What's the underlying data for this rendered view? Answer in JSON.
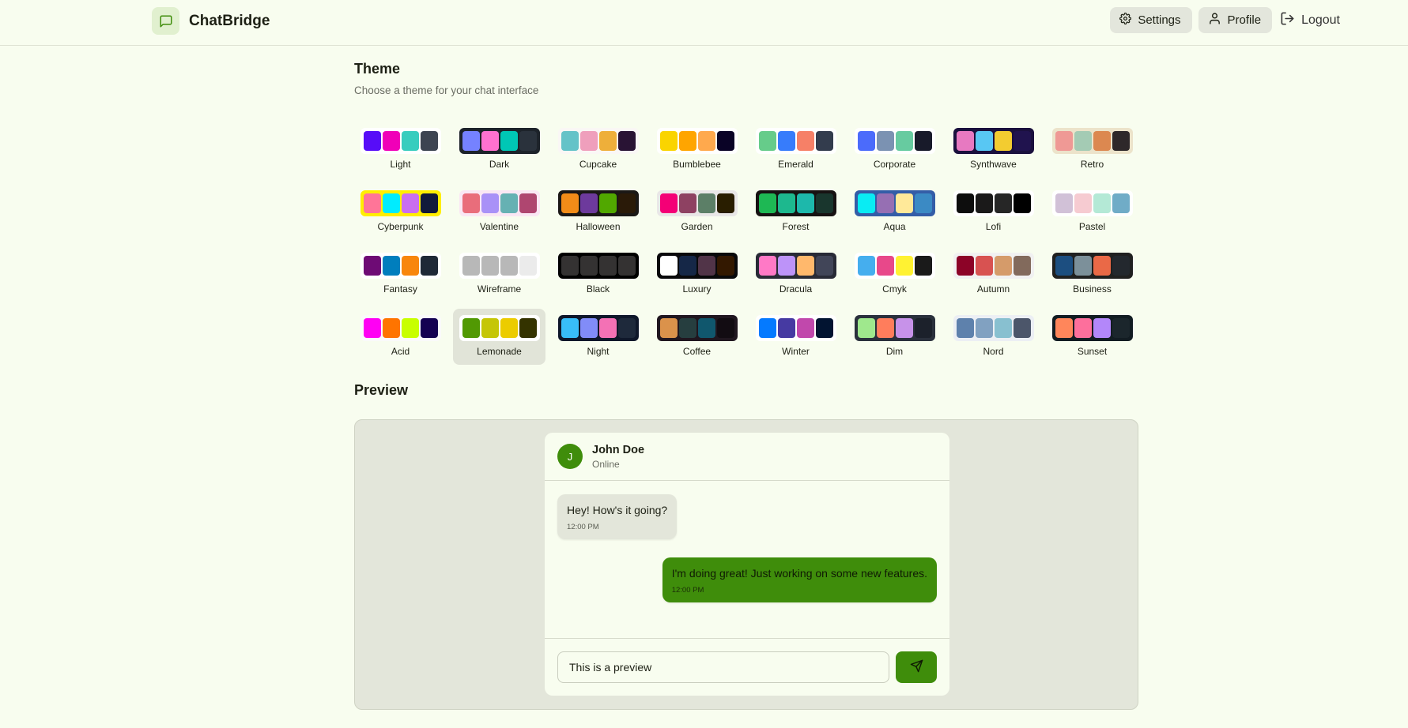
{
  "header": {
    "app_name": "ChatBridge",
    "logo_icon": "message-square-icon",
    "accent": "#3f8d0b",
    "nav": {
      "settings_label": "Settings",
      "profile_label": "Profile",
      "logout_label": "Logout"
    }
  },
  "theme_section": {
    "title": "Theme",
    "subtitle": "Choose a theme for your chat interface",
    "selected": "Lemonade",
    "themes": [
      {
        "name": "Light",
        "bg": "#ffffff",
        "border": "#ffffff",
        "colors": [
          "#570df8",
          "#f000b8",
          "#37cdbe",
          "#3d4451"
        ]
      },
      {
        "name": "Dark",
        "bg": "#1d232a",
        "border": "#1d232a",
        "colors": [
          "#7582ff",
          "#ff71cf",
          "#00c7b5",
          "#2a323c"
        ]
      },
      {
        "name": "Cupcake",
        "bg": "#faf7f5",
        "border": "#faf7f5",
        "colors": [
          "#65c3c8",
          "#ef9fbc",
          "#eeaf3a",
          "#291334"
        ]
      },
      {
        "name": "Bumblebee",
        "bg": "#ffffff",
        "border": "#ffffff",
        "colors": [
          "#fad400",
          "#ffa500",
          "#ffa94d",
          "#0a0326"
        ]
      },
      {
        "name": "Emerald",
        "bg": "#ffffff",
        "border": "#ffffff",
        "colors": [
          "#66cc8a",
          "#377cfb",
          "#f68067",
          "#333c4d"
        ]
      },
      {
        "name": "Corporate",
        "bg": "#ffffff",
        "border": "#ffffff",
        "colors": [
          "#4b6bfb",
          "#7b92b2",
          "#67cba0",
          "#181a2a"
        ]
      },
      {
        "name": "Synthwave",
        "bg": "#1a103d",
        "border": "#1a103d",
        "colors": [
          "#e779c1",
          "#58c7f3",
          "#f3cc30",
          "#20134e"
        ]
      },
      {
        "name": "Retro",
        "bg": "#ece3ca",
        "border": "#ece3ca",
        "colors": [
          "#ef9995",
          "#a4cbb4",
          "#dc8850",
          "#2e282a"
        ]
      },
      {
        "name": "Cyberpunk",
        "bg": "#ffee00",
        "border": "#ffee00",
        "colors": [
          "#ff7598",
          "#00ecff",
          "#c96ef0",
          "#111a3b"
        ]
      },
      {
        "name": "Valentine",
        "bg": "#fae7f4",
        "border": "#fae7f4",
        "colors": [
          "#e96d7b",
          "#a991f7",
          "#66b1b3",
          "#af4670"
        ]
      },
      {
        "name": "Halloween",
        "bg": "#1b1816",
        "border": "#1b1816",
        "colors": [
          "#f28c18",
          "#6d3a9c",
          "#51a800",
          "#2a1a08"
        ]
      },
      {
        "name": "Garden",
        "bg": "#e9e7e7",
        "border": "#e9e7e7",
        "colors": [
          "#f40076",
          "#8e4162",
          "#5c7f67",
          "#291e00"
        ]
      },
      {
        "name": "Forest",
        "bg": "#171212",
        "border": "#171212",
        "colors": [
          "#1eb854",
          "#1db88e",
          "#1db8ab",
          "#19362d"
        ]
      },
      {
        "name": "Aqua",
        "bg": "#345da7",
        "border": "#345da7",
        "colors": [
          "#09ecf3",
          "#966fb3",
          "#ffe999",
          "#3b8ac4"
        ]
      },
      {
        "name": "Lofi",
        "bg": "#ffffff",
        "border": "#ffffff",
        "colors": [
          "#0d0d0d",
          "#1a1919",
          "#262626",
          "#000000"
        ]
      },
      {
        "name": "Pastel",
        "bg": "#ffffff",
        "border": "#ffffff",
        "colors": [
          "#d1c1d7",
          "#f6cbd1",
          "#b4e9d6",
          "#70acc7"
        ]
      },
      {
        "name": "Fantasy",
        "bg": "#ffffff",
        "border": "#ffffff",
        "colors": [
          "#6e0b75",
          "#007ebd",
          "#f8860d",
          "#1f2937"
        ]
      },
      {
        "name": "Wireframe",
        "bg": "#ffffff",
        "border": "#ffffff",
        "colors": [
          "#b8b8b8",
          "#b8b8b8",
          "#b8b8b8",
          "#ebebeb"
        ]
      },
      {
        "name": "Black",
        "bg": "#000000",
        "border": "#000000",
        "colors": [
          "#343232",
          "#343232",
          "#343232",
          "#343232"
        ]
      },
      {
        "name": "Luxury",
        "bg": "#09090b",
        "border": "#09090b",
        "colors": [
          "#ffffff",
          "#152747",
          "#513448",
          "#331800"
        ]
      },
      {
        "name": "Dracula",
        "bg": "#282a36",
        "border": "#282a36",
        "colors": [
          "#ff79c6",
          "#bd93f9",
          "#ffb86c",
          "#414558"
        ]
      },
      {
        "name": "Cmyk",
        "bg": "#ffffff",
        "border": "#ffffff",
        "colors": [
          "#45aeee",
          "#e8488a",
          "#fff232",
          "#1a1a1a"
        ]
      },
      {
        "name": "Autumn",
        "bg": "#f1f1f1",
        "border": "#f1f1f1",
        "colors": [
          "#8c0327",
          "#d85251",
          "#d59b6a",
          "#826a5c"
        ]
      },
      {
        "name": "Business",
        "bg": "#202020",
        "border": "#202020",
        "colors": [
          "#1c4e80",
          "#7c909a",
          "#ea6947",
          "#23282e"
        ]
      },
      {
        "name": "Acid",
        "bg": "#fafafa",
        "border": "#fafafa",
        "colors": [
          "#ff00f4",
          "#ff7400",
          "#c8ff00",
          "#140152"
        ]
      },
      {
        "name": "Lemonade",
        "bg": "#ffffff",
        "border": "#ffffff",
        "colors": [
          "#519903",
          "#c5c607",
          "#eccc00",
          "#343300"
        ]
      },
      {
        "name": "Night",
        "bg": "#0f172a",
        "border": "#0f172a",
        "colors": [
          "#38bdf8",
          "#818cf8",
          "#f471b5",
          "#1e293b"
        ]
      },
      {
        "name": "Coffee",
        "bg": "#20161f",
        "border": "#20161f",
        "colors": [
          "#db924b",
          "#263e3f",
          "#10576d",
          "#120c12"
        ]
      },
      {
        "name": "Winter",
        "bg": "#ffffff",
        "border": "#ffffff",
        "colors": [
          "#047aff",
          "#463aa2",
          "#c148ac",
          "#021431"
        ]
      },
      {
        "name": "Dim",
        "bg": "#2a303c",
        "border": "#2a303c",
        "colors": [
          "#9fe88d",
          "#ff7d5c",
          "#c792e9",
          "#1c212b"
        ]
      },
      {
        "name": "Nord",
        "bg": "#eceff4",
        "border": "#eceff4",
        "colors": [
          "#5e81ac",
          "#81a1c1",
          "#88c0d0",
          "#4c566a"
        ]
      },
      {
        "name": "Sunset",
        "bg": "#121c22",
        "border": "#121c22",
        "colors": [
          "#ff865b",
          "#fd6f9c",
          "#b387fa",
          "#1b262c"
        ]
      }
    ]
  },
  "preview": {
    "title": "Preview",
    "contact": {
      "initial": "J",
      "name": "John Doe",
      "status": "Online"
    },
    "messages": [
      {
        "direction": "incoming",
        "text": "Hey! How's it going?",
        "time": "12:00 PM"
      },
      {
        "direction": "outgoing",
        "text": "I'm doing great! Just working on some new features.",
        "time": "12:00 PM"
      }
    ],
    "input_value": "This is a preview",
    "send_icon": "send-icon"
  }
}
